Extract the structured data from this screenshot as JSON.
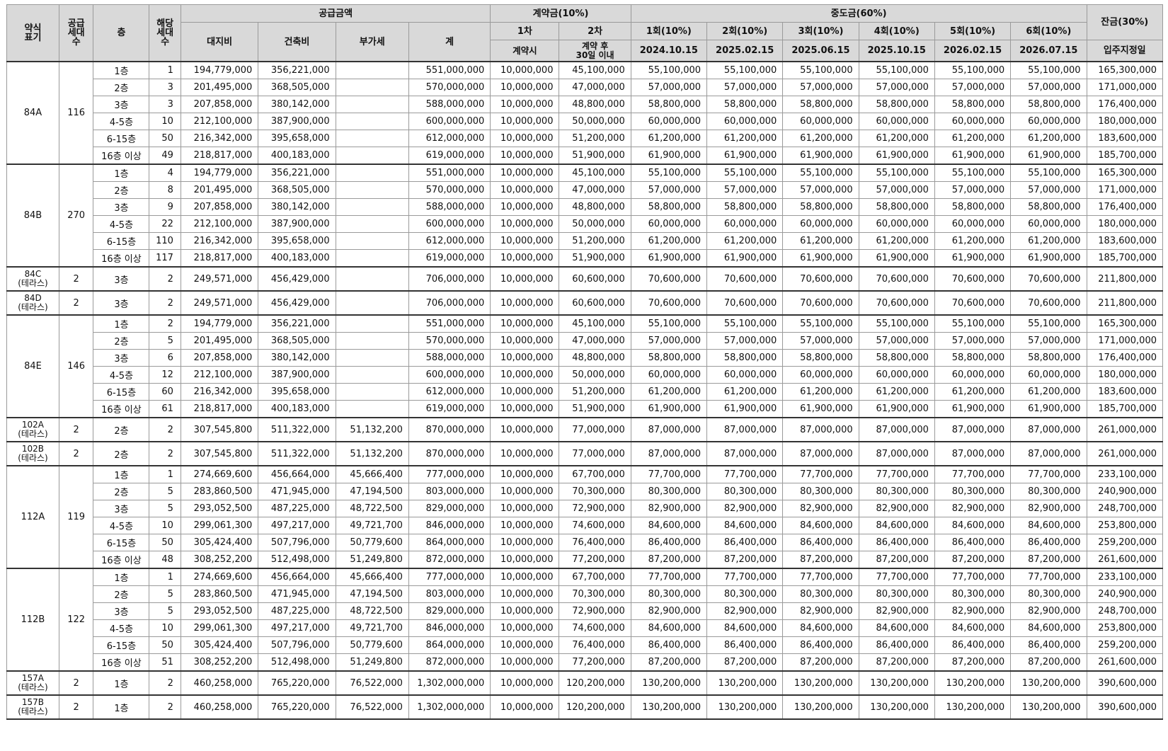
{
  "header": {
    "type": "약식\n표기",
    "units": "공급\n세대\n수",
    "floor": "층",
    "floor_units": "해당\n세대\n수",
    "supply": "공급금액",
    "land": "대지비",
    "build": "건축비",
    "vat": "부가세",
    "total": "계",
    "deposit": "계약금(10%)",
    "dep1": "1차",
    "dep2": "2차",
    "dep1_when": "계약시",
    "dep2_when": "계약 후\n30일 이내",
    "middle": "중도금(60%)",
    "mid_labels": [
      "1회(10%)",
      "2회(10%)",
      "3회(10%)",
      "4회(10%)",
      "5회(10%)",
      "6회(10%)"
    ],
    "mid_dates": [
      "2024.10.15",
      "2025.02.15",
      "2025.06.15",
      "2025.10.15",
      "2026.02.15",
      "2026.07.15"
    ],
    "balance": "잔금(30%)",
    "balance_when": "입주지정일"
  },
  "groups": [
    {
      "type": "84A",
      "units": "116",
      "rows": [
        [
          "1층",
          "1",
          "194,779,000",
          "356,221,000",
          "",
          "551,000,000",
          "10,000,000",
          "45,100,000",
          "55,100,000",
          "165,300,000"
        ],
        [
          "2층",
          "3",
          "201,495,000",
          "368,505,000",
          "",
          "570,000,000",
          "10,000,000",
          "47,000,000",
          "57,000,000",
          "171,000,000"
        ],
        [
          "3층",
          "3",
          "207,858,000",
          "380,142,000",
          "",
          "588,000,000",
          "10,000,000",
          "48,800,000",
          "58,800,000",
          "176,400,000"
        ],
        [
          "4-5층",
          "10",
          "212,100,000",
          "387,900,000",
          "",
          "600,000,000",
          "10,000,000",
          "50,000,000",
          "60,000,000",
          "180,000,000"
        ],
        [
          "6-15층",
          "50",
          "216,342,000",
          "395,658,000",
          "",
          "612,000,000",
          "10,000,000",
          "51,200,000",
          "61,200,000",
          "183,600,000"
        ],
        [
          "16층 이상",
          "49",
          "218,817,000",
          "400,183,000",
          "",
          "619,000,000",
          "10,000,000",
          "51,900,000",
          "61,900,000",
          "185,700,000"
        ]
      ]
    },
    {
      "type": "84B",
      "units": "270",
      "rows": [
        [
          "1층",
          "4",
          "194,779,000",
          "356,221,000",
          "",
          "551,000,000",
          "10,000,000",
          "45,100,000",
          "55,100,000",
          "165,300,000"
        ],
        [
          "2층",
          "8",
          "201,495,000",
          "368,505,000",
          "",
          "570,000,000",
          "10,000,000",
          "47,000,000",
          "57,000,000",
          "171,000,000"
        ],
        [
          "3층",
          "9",
          "207,858,000",
          "380,142,000",
          "",
          "588,000,000",
          "10,000,000",
          "48,800,000",
          "58,800,000",
          "176,400,000"
        ],
        [
          "4-5층",
          "22",
          "212,100,000",
          "387,900,000",
          "",
          "600,000,000",
          "10,000,000",
          "50,000,000",
          "60,000,000",
          "180,000,000"
        ],
        [
          "6-15층",
          "110",
          "216,342,000",
          "395,658,000",
          "",
          "612,000,000",
          "10,000,000",
          "51,200,000",
          "61,200,000",
          "183,600,000"
        ],
        [
          "16층 이상",
          "117",
          "218,817,000",
          "400,183,000",
          "",
          "619,000,000",
          "10,000,000",
          "51,900,000",
          "61,900,000",
          "185,700,000"
        ]
      ]
    },
    {
      "type": "84C\n(테라스)",
      "units": "2",
      "rows": [
        [
          "3층",
          "2",
          "249,571,000",
          "456,429,000",
          "",
          "706,000,000",
          "10,000,000",
          "60,600,000",
          "70,600,000",
          "211,800,000"
        ]
      ]
    },
    {
      "type": "84D\n(테라스)",
      "units": "2",
      "rows": [
        [
          "3층",
          "2",
          "249,571,000",
          "456,429,000",
          "",
          "706,000,000",
          "10,000,000",
          "60,600,000",
          "70,600,000",
          "211,800,000"
        ]
      ]
    },
    {
      "type": "84E",
      "units": "146",
      "rows": [
        [
          "1층",
          "2",
          "194,779,000",
          "356,221,000",
          "",
          "551,000,000",
          "10,000,000",
          "45,100,000",
          "55,100,000",
          "165,300,000"
        ],
        [
          "2층",
          "5",
          "201,495,000",
          "368,505,000",
          "",
          "570,000,000",
          "10,000,000",
          "47,000,000",
          "57,000,000",
          "171,000,000"
        ],
        [
          "3층",
          "6",
          "207,858,000",
          "380,142,000",
          "",
          "588,000,000",
          "10,000,000",
          "48,800,000",
          "58,800,000",
          "176,400,000"
        ],
        [
          "4-5층",
          "12",
          "212,100,000",
          "387,900,000",
          "",
          "600,000,000",
          "10,000,000",
          "50,000,000",
          "60,000,000",
          "180,000,000"
        ],
        [
          "6-15층",
          "60",
          "216,342,000",
          "395,658,000",
          "",
          "612,000,000",
          "10,000,000",
          "51,200,000",
          "61,200,000",
          "183,600,000"
        ],
        [
          "16층 이상",
          "61",
          "218,817,000",
          "400,183,000",
          "",
          "619,000,000",
          "10,000,000",
          "51,900,000",
          "61,900,000",
          "185,700,000"
        ]
      ]
    },
    {
      "type": "102A\n(테라스)",
      "units": "2",
      "rows": [
        [
          "2층",
          "2",
          "307,545,800",
          "511,322,000",
          "51,132,200",
          "870,000,000",
          "10,000,000",
          "77,000,000",
          "87,000,000",
          "261,000,000"
        ]
      ]
    },
    {
      "type": "102B\n(테라스)",
      "units": "2",
      "rows": [
        [
          "2층",
          "2",
          "307,545,800",
          "511,322,000",
          "51,132,200",
          "870,000,000",
          "10,000,000",
          "77,000,000",
          "87,000,000",
          "261,000,000"
        ]
      ]
    },
    {
      "type": "112A",
      "units": "119",
      "rows": [
        [
          "1층",
          "1",
          "274,669,600",
          "456,664,000",
          "45,666,400",
          "777,000,000",
          "10,000,000",
          "67,700,000",
          "77,700,000",
          "233,100,000"
        ],
        [
          "2층",
          "5",
          "283,860,500",
          "471,945,000",
          "47,194,500",
          "803,000,000",
          "10,000,000",
          "70,300,000",
          "80,300,000",
          "240,900,000"
        ],
        [
          "3층",
          "5",
          "293,052,500",
          "487,225,000",
          "48,722,500",
          "829,000,000",
          "10,000,000",
          "72,900,000",
          "82,900,000",
          "248,700,000"
        ],
        [
          "4-5층",
          "10",
          "299,061,300",
          "497,217,000",
          "49,721,700",
          "846,000,000",
          "10,000,000",
          "74,600,000",
          "84,600,000",
          "253,800,000"
        ],
        [
          "6-15층",
          "50",
          "305,424,400",
          "507,796,000",
          "50,779,600",
          "864,000,000",
          "10,000,000",
          "76,400,000",
          "86,400,000",
          "259,200,000"
        ],
        [
          "16층 이상",
          "48",
          "308,252,200",
          "512,498,000",
          "51,249,800",
          "872,000,000",
          "10,000,000",
          "77,200,000",
          "87,200,000",
          "261,600,000"
        ]
      ]
    },
    {
      "type": "112B",
      "units": "122",
      "rows": [
        [
          "1층",
          "1",
          "274,669,600",
          "456,664,000",
          "45,666,400",
          "777,000,000",
          "10,000,000",
          "67,700,000",
          "77,700,000",
          "233,100,000"
        ],
        [
          "2층",
          "5",
          "283,860,500",
          "471,945,000",
          "47,194,500",
          "803,000,000",
          "10,000,000",
          "70,300,000",
          "80,300,000",
          "240,900,000"
        ],
        [
          "3층",
          "5",
          "293,052,500",
          "487,225,000",
          "48,722,500",
          "829,000,000",
          "10,000,000",
          "72,900,000",
          "82,900,000",
          "248,700,000"
        ],
        [
          "4-5층",
          "10",
          "299,061,300",
          "497,217,000",
          "49,721,700",
          "846,000,000",
          "10,000,000",
          "74,600,000",
          "84,600,000",
          "253,800,000"
        ],
        [
          "6-15층",
          "50",
          "305,424,400",
          "507,796,000",
          "50,779,600",
          "864,000,000",
          "10,000,000",
          "76,400,000",
          "86,400,000",
          "259,200,000"
        ],
        [
          "16층 이상",
          "51",
          "308,252,200",
          "512,498,000",
          "51,249,800",
          "872,000,000",
          "10,000,000",
          "77,200,000",
          "87,200,000",
          "261,600,000"
        ]
      ]
    },
    {
      "type": "157A\n(테라스)",
      "units": "2",
      "rows": [
        [
          "1층",
          "2",
          "460,258,000",
          "765,220,000",
          "76,522,000",
          "1,302,000,000",
          "10,000,000",
          "120,200,000",
          "130,200,000",
          "390,600,000"
        ]
      ]
    },
    {
      "type": "157B\n(테라스)",
      "units": "2",
      "rows": [
        [
          "1층",
          "2",
          "460,258,000",
          "765,220,000",
          "76,522,000",
          "1,302,000,000",
          "10,000,000",
          "120,200,000",
          "130,200,000",
          "390,600,000"
        ]
      ]
    }
  ]
}
